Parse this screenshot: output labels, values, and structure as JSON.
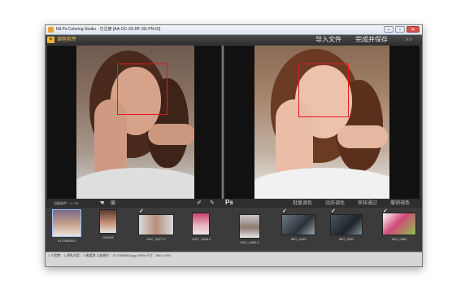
{
  "window": {
    "title": "Nit Ps-Coloring Studio · 已注册 [AA-OC-3S-HF-3G-PN-ID]"
  },
  "toolbar": {
    "app_name": "调色软件",
    "import_label": "导入文件",
    "save_label": "完成并保存",
    "next_label": ">>"
  },
  "filmstrip": {
    "count_label": "当前选中：1 / 10",
    "ps_label": "Ps",
    "tabs": [
      "批量调色",
      "动态调色",
      "审核通过",
      "撤销调色"
    ],
    "thumbs": [
      {
        "caption": "0172555810",
        "selected": true,
        "checked": false
      },
      {
        "caption": "DSI455",
        "selected": false,
        "checked": false
      },
      {
        "caption": "DSC_3477-2",
        "selected": false,
        "checked": true
      },
      {
        "caption": "DSC_4465-1",
        "selected": false,
        "checked": false
      },
      {
        "caption": "DSC_4480-2",
        "selected": false,
        "checked": false
      },
      {
        "caption": "IMG_0403",
        "selected": false,
        "checked": true
      },
      {
        "caption": "IMG_0632",
        "selected": false,
        "checked": true
      },
      {
        "caption": "IMG_0880",
        "selected": false,
        "checked": true
      }
    ]
  },
  "status": {
    "text": "1  人脸数：1  调色方案：人像柔肤  当前图片：0172555810.jpg  100%  尺寸：800 × 600"
  },
  "colors": {
    "face_box": "#e01b1b",
    "app_name": "#f2c94c"
  }
}
